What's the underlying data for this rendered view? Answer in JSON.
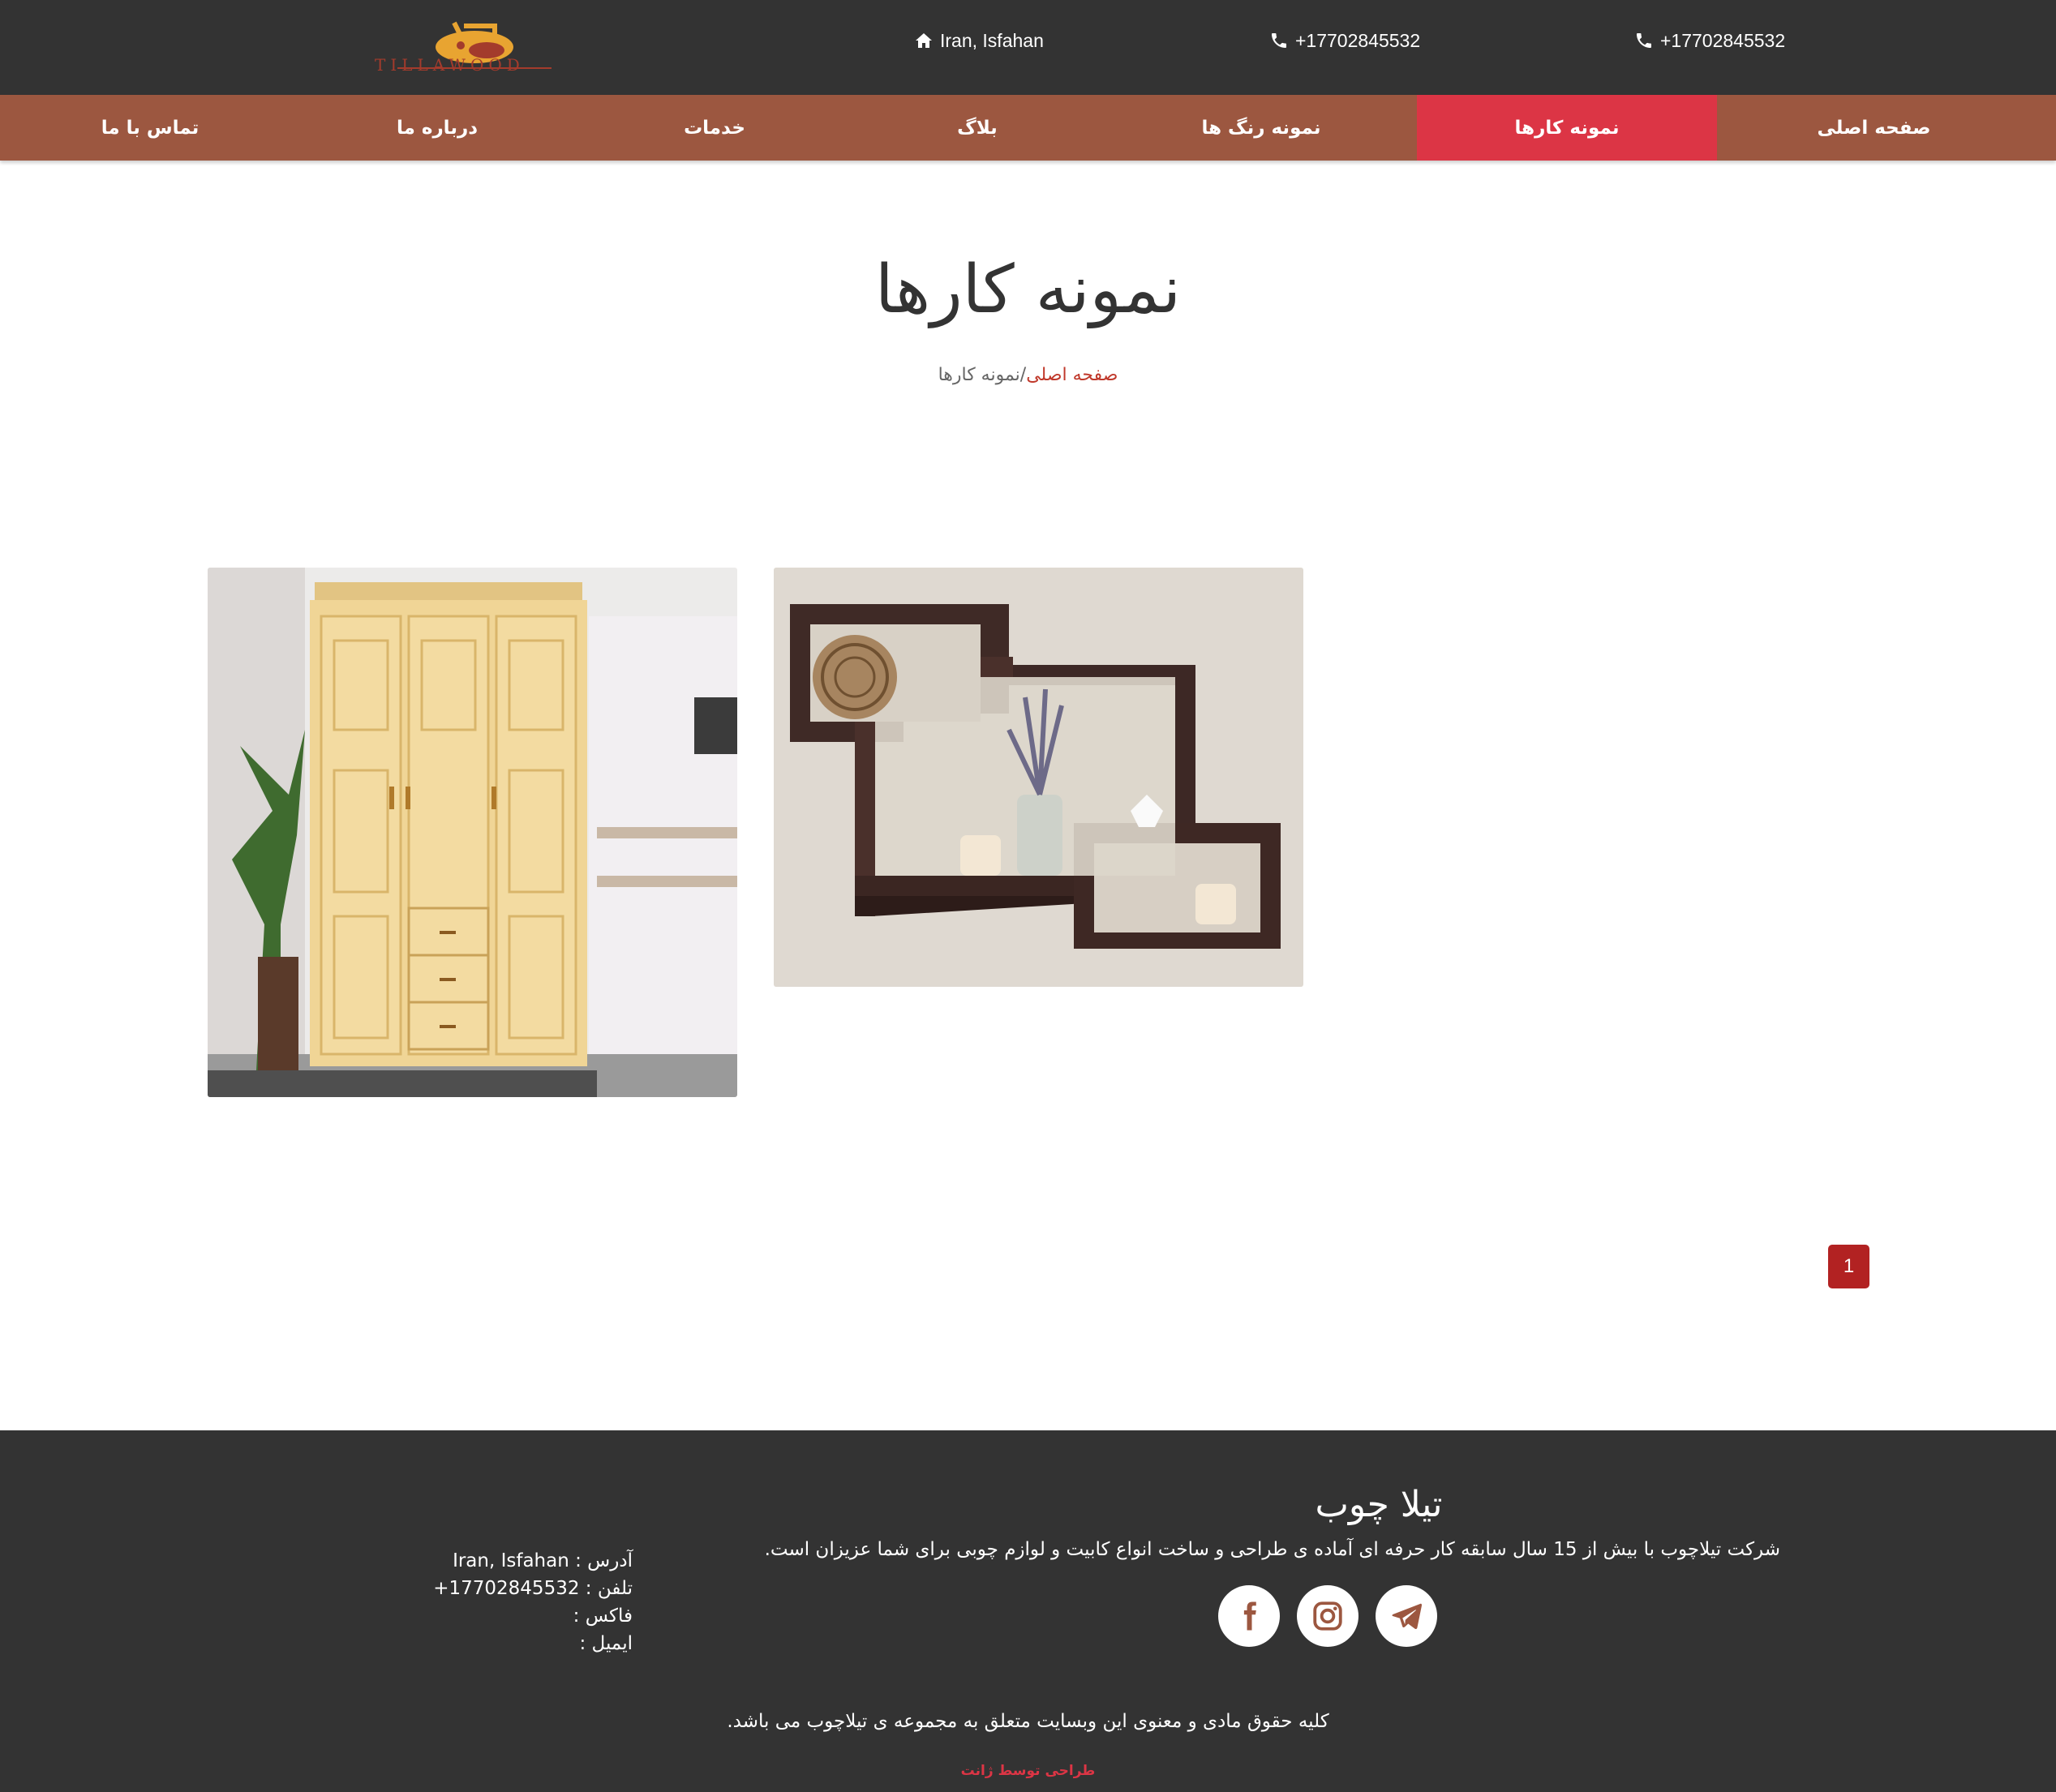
{
  "topbar": {
    "logo_text": "TILLAWOOD",
    "location": "Iran, Isfahan",
    "phone_1": "+17702845532",
    "phone_2": "+17702845532"
  },
  "nav": {
    "home": "صفحه اصلی",
    "portfolio": "نمونه کارها",
    "colors": "نمونه رنگ ها",
    "blog": "بلاگ",
    "services": "خدمات",
    "about": "درباره ما",
    "contact": "تماس با ما"
  },
  "page": {
    "title": "نمونه کارها",
    "breadcrumb_home": "صفحه اصلی",
    "breadcrumb_sep": "/",
    "breadcrumb_current": "نمونه کارها"
  },
  "pagination": {
    "current": "1"
  },
  "footer": {
    "brand": "تیلا چوب",
    "description": "شرکت تیلاچوب با بیش از 15 سال سابقه کار حرفه ای آماده ی طراحی و ساخت انواع کابیت و لوازم چوبی برای شما عزیزان است.",
    "address": "آدرس : Iran, Isfahan",
    "phone": "تلفن : 17702845532+",
    "fax": "فاکس :",
    "email": "ایمیل :",
    "copyright": "کلیه حقوق مادی و معنوی این وبسایت متعلق به مجموعه ی تیلاچوب می باشد.",
    "credit": "طراحی توسط ژانت"
  },
  "colors": {
    "dark": "#333333",
    "nav": "#9c5740",
    "active": "#dc3545",
    "link": "#c0392b",
    "page_button": "#b22222"
  },
  "icons": [
    "home-icon",
    "phone-icon",
    "telegram-icon",
    "instagram-icon",
    "facebook-icon"
  ]
}
